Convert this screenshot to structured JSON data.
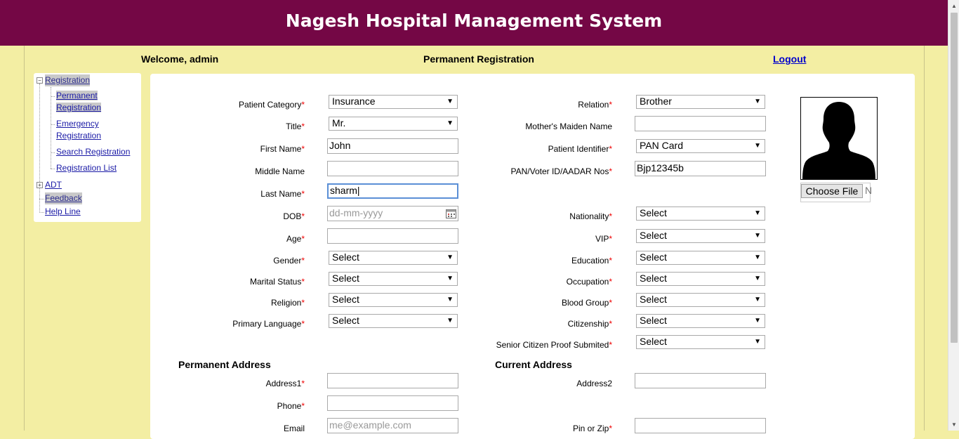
{
  "app": {
    "title": "Nagesh Hospital Management System"
  },
  "topbar": {
    "welcome": "Welcome, admin",
    "page_title": "Permanent Registration",
    "logout": "Logout"
  },
  "sidebar": {
    "registration": "Registration",
    "sub": {
      "permanent_1": "Permanent",
      "permanent_2": "Registration",
      "emergency_1": "Emergency",
      "emergency_2": "Registration",
      "search": "Search Registration",
      "list": "Registration List"
    },
    "adt": "ADT",
    "feedback": "Feedback",
    "helpline": "Help Line"
  },
  "form": {
    "patient_category": {
      "label": "Patient Category",
      "value": "Insurance"
    },
    "title": {
      "label": "Title",
      "value": "Mr."
    },
    "first_name": {
      "label": "First Name",
      "value": "John"
    },
    "middle_name": {
      "label": "Middle Name",
      "value": ""
    },
    "last_name": {
      "label": "Last Name",
      "value": "sharm"
    },
    "dob": {
      "label": "DOB",
      "placeholder": "dd-mm-yyyy"
    },
    "age": {
      "label": "Age",
      "value": ""
    },
    "gender": {
      "label": "Gender",
      "value": "Select"
    },
    "marital_status": {
      "label": "Marital Status",
      "value": "Select"
    },
    "religion": {
      "label": "Religion",
      "value": "Select"
    },
    "primary_language": {
      "label": "Primary Language",
      "value": "Select"
    },
    "relation": {
      "label": "Relation",
      "value": "Brother"
    },
    "mothers_maiden_name": {
      "label": "Mother's Maiden Name",
      "value": ""
    },
    "patient_identifier": {
      "label": "Patient Identifier",
      "value": "PAN Card"
    },
    "id_nos": {
      "label": "PAN/Voter ID/AADAR Nos",
      "value": "Bjp12345b"
    },
    "nationality": {
      "label": "Nationality",
      "value": "Select"
    },
    "vip": {
      "label": "VIP",
      "value": "Select"
    },
    "education": {
      "label": "Education",
      "value": "Select"
    },
    "occupation": {
      "label": "Occupation",
      "value": "Select"
    },
    "blood_group": {
      "label": "Blood Group",
      "value": "Select"
    },
    "citizenship": {
      "label": "Citizenship",
      "value": "Select"
    },
    "senior_citizen_proof": {
      "label": "Senior Citizen Proof Submited",
      "value": "Select"
    },
    "required_mark": "*",
    "photo": {
      "icon": "person-silhouette-icon",
      "choose_file": "Choose File",
      "no_file_char": "N"
    }
  },
  "permanent_address": {
    "title": "Permanent Address",
    "address1": {
      "label": "Address1",
      "value": ""
    },
    "phone": {
      "label": "Phone",
      "value": ""
    },
    "email": {
      "label": "Email",
      "placeholder": "me@example.com"
    }
  },
  "current_address": {
    "title": "Current Address",
    "address2": {
      "label": "Address2",
      "value": ""
    },
    "pin": {
      "label": "Pin or Zip",
      "value": ""
    }
  },
  "colors": {
    "header": "#740745",
    "background": "#f3eea3",
    "required": "#e00000",
    "link": "#1a1aa6"
  }
}
